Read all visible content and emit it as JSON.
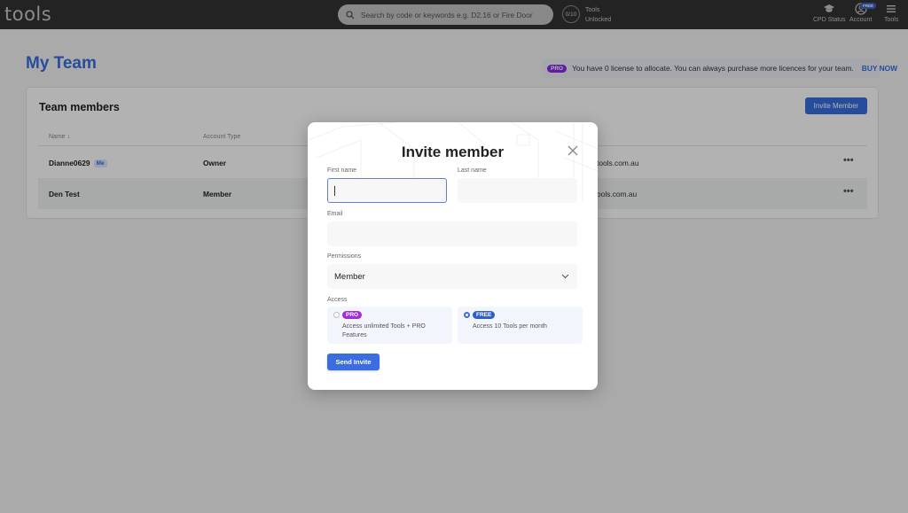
{
  "topbar": {
    "logo": "tools",
    "search_placeholder": "Search by code or keywords e.g. D2.16 or Fire Door",
    "tools_count": "0/10",
    "tools_label_1": "Tools",
    "tools_label_2": "Unlocked",
    "nav": [
      {
        "label": "CPD Status",
        "icon": "graduation-cap-icon"
      },
      {
        "label": "Account",
        "icon": "account-icon",
        "badge": "FREE"
      },
      {
        "label": "Tools",
        "icon": "menu-icon"
      }
    ]
  },
  "page": {
    "title": "My Team",
    "banner": {
      "pill": "PRO",
      "text": "You have 0 license to allocate. You can always purchase more licences for your team.",
      "action": "BUY NOW"
    }
  },
  "team": {
    "title": "Team members",
    "invite_button": "Invite Member",
    "columns": [
      "Name ↓",
      "Account Type"
    ],
    "rows": [
      {
        "name": "Dianne0629",
        "badge": "Me",
        "type": "Owner",
        "email_partial": "tools.com.au"
      },
      {
        "name": "Den Test",
        "badge": "",
        "type": "Member",
        "email_partial": "ools.com.au"
      }
    ]
  },
  "modal": {
    "title": "Invite member",
    "first_name_label": "First name",
    "first_name_value": "",
    "last_name_label": "Last name",
    "last_name_value": "",
    "email_label": "Email",
    "email_value": "",
    "permissions_label": "Permissions",
    "permissions_value": "Member",
    "access_label": "Access",
    "access_options": [
      {
        "badge": "PRO",
        "description": "Access unlimited Tools + PRO Features",
        "selected": false
      },
      {
        "badge": "FREE",
        "description": "Access 10 Tools per month",
        "selected": true
      }
    ],
    "send_button": "Send Invite"
  },
  "colors": {
    "accent": "#3a6ee0",
    "pro": "#a42ce0",
    "free": "#2f5ec9",
    "topbar": "#333333"
  }
}
